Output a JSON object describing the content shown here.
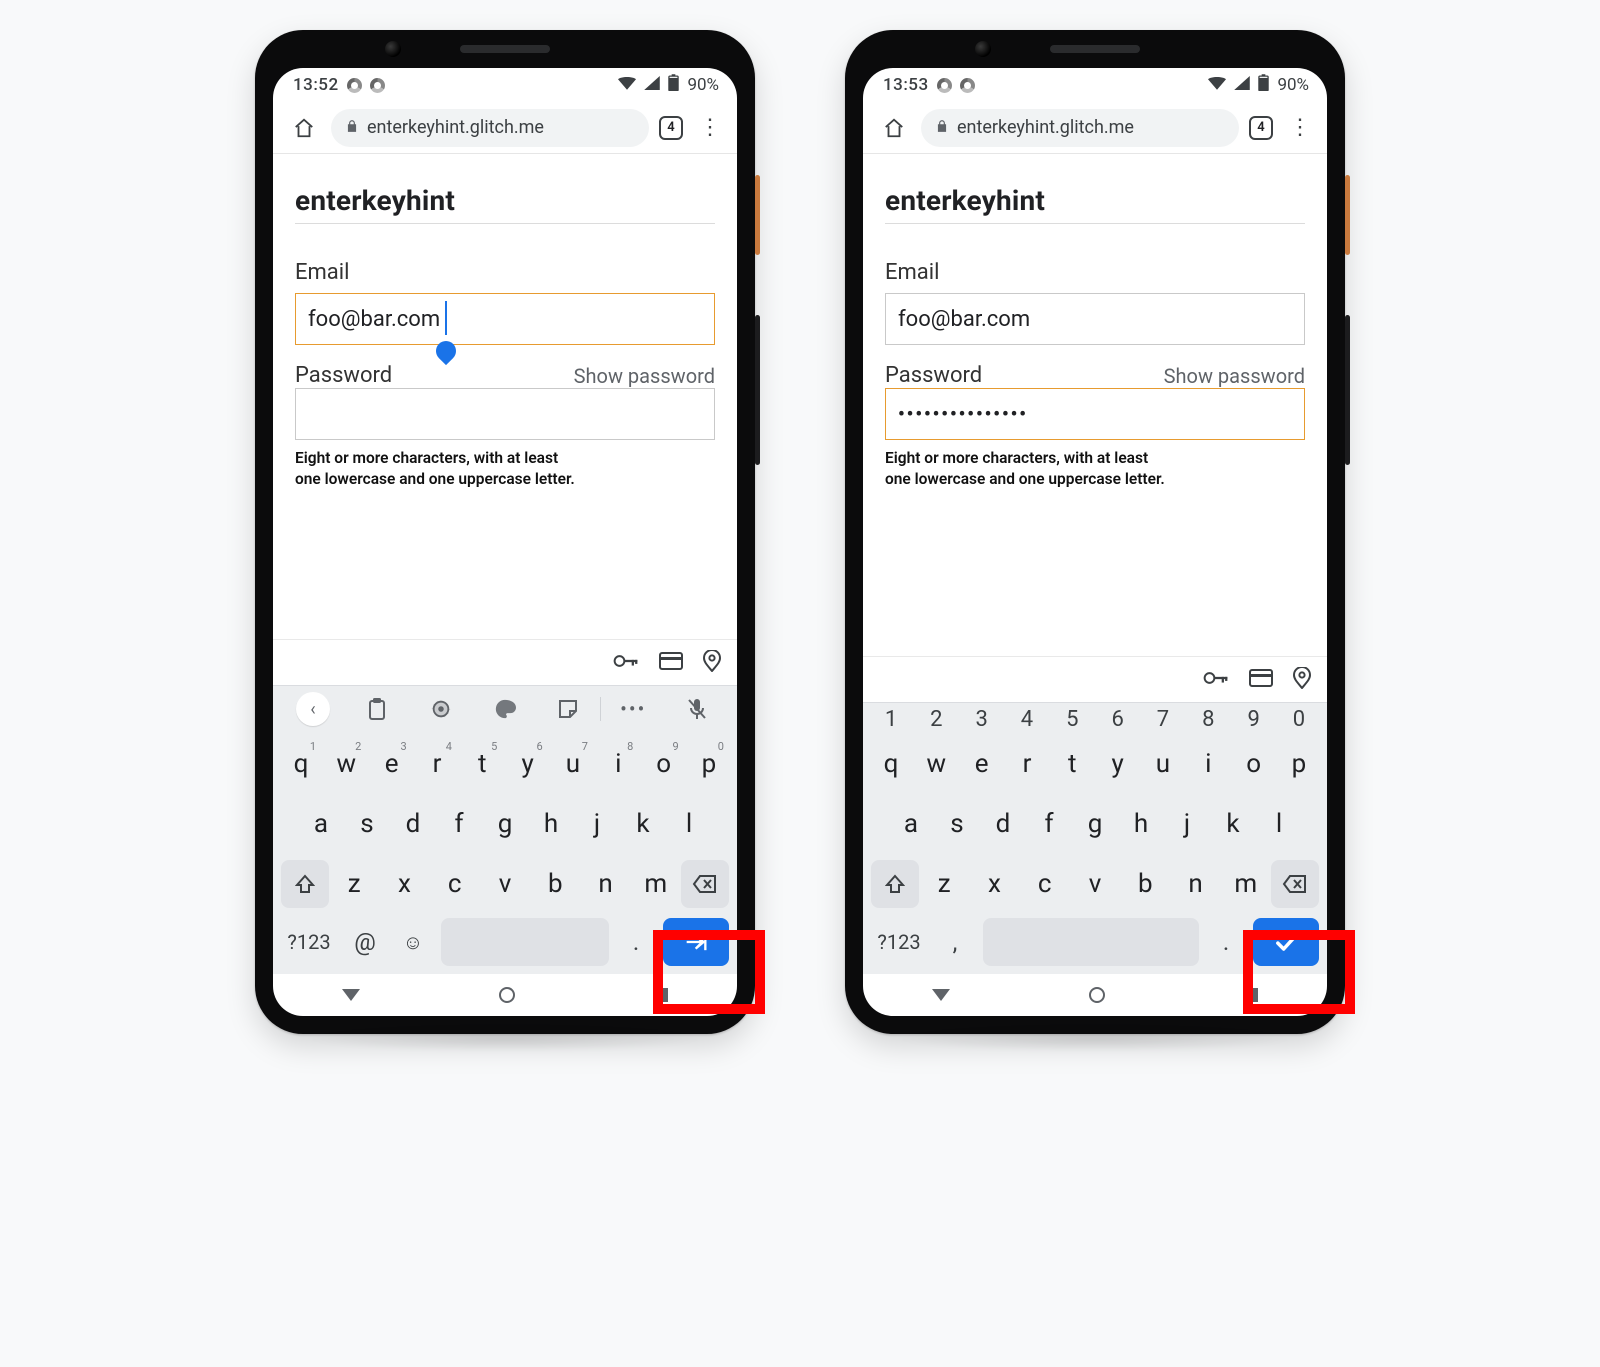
{
  "phones": [
    {
      "statusbar": {
        "time": "13:52",
        "battery": "90%"
      },
      "omnibox": {
        "url": "enterkeyhint.glitch.me",
        "tab_count": "4"
      },
      "page": {
        "title": "enterkeyhint",
        "email_label": "Email",
        "email_value": "foo@bar.com",
        "email_focused": true,
        "password_label": "Password",
        "show_password": "Show password",
        "password_value": "",
        "password_focused": false,
        "help_line1": "Eight or more characters, with at least",
        "help_line2": "one lowercase and one uppercase letter."
      },
      "keyboard": {
        "variant": "email",
        "toolbar": true,
        "sym_label": "?123",
        "at_label": "@",
        "dot_label": ".",
        "enter_icon": "next"
      }
    },
    {
      "statusbar": {
        "time": "13:53",
        "battery": "90%"
      },
      "omnibox": {
        "url": "enterkeyhint.glitch.me",
        "tab_count": "4"
      },
      "page": {
        "title": "enterkeyhint",
        "email_label": "Email",
        "email_value": "foo@bar.com",
        "email_focused": false,
        "password_label": "Password",
        "show_password": "Show password",
        "password_value": "•••••••••••••••",
        "password_focused": true,
        "help_line1": "Eight or more characters, with at least",
        "help_line2": "one lowercase and one uppercase letter."
      },
      "keyboard": {
        "variant": "password",
        "toolbar": false,
        "sym_label": "?123",
        "comma_label": ",",
        "dot_label": ".",
        "enter_icon": "done"
      }
    }
  ],
  "keys": {
    "row1": [
      "q",
      "w",
      "e",
      "r",
      "t",
      "y",
      "u",
      "i",
      "o",
      "p"
    ],
    "row1_sup": [
      "1",
      "2",
      "3",
      "4",
      "5",
      "6",
      "7",
      "8",
      "9",
      "0"
    ],
    "row2": [
      "a",
      "s",
      "d",
      "f",
      "g",
      "h",
      "j",
      "k",
      "l"
    ],
    "row3": [
      "z",
      "x",
      "c",
      "v",
      "b",
      "n",
      "m"
    ],
    "numbers": [
      "1",
      "2",
      "3",
      "4",
      "5",
      "6",
      "7",
      "8",
      "9",
      "0"
    ]
  },
  "icons": {
    "home": "home-icon",
    "lock": "lock-icon",
    "menu": "menu-icon",
    "key": "key-icon",
    "card": "card-icon",
    "pin": "pin-icon",
    "shift": "shift-icon",
    "backspace": "backspace-icon",
    "mic": "mic-off-icon",
    "clipboard": "clipboard-icon",
    "gear": "gear-icon",
    "palette": "palette-icon",
    "sticker": "sticker-icon",
    "dots": "dots-icon",
    "emoji": "emoji-icon"
  }
}
